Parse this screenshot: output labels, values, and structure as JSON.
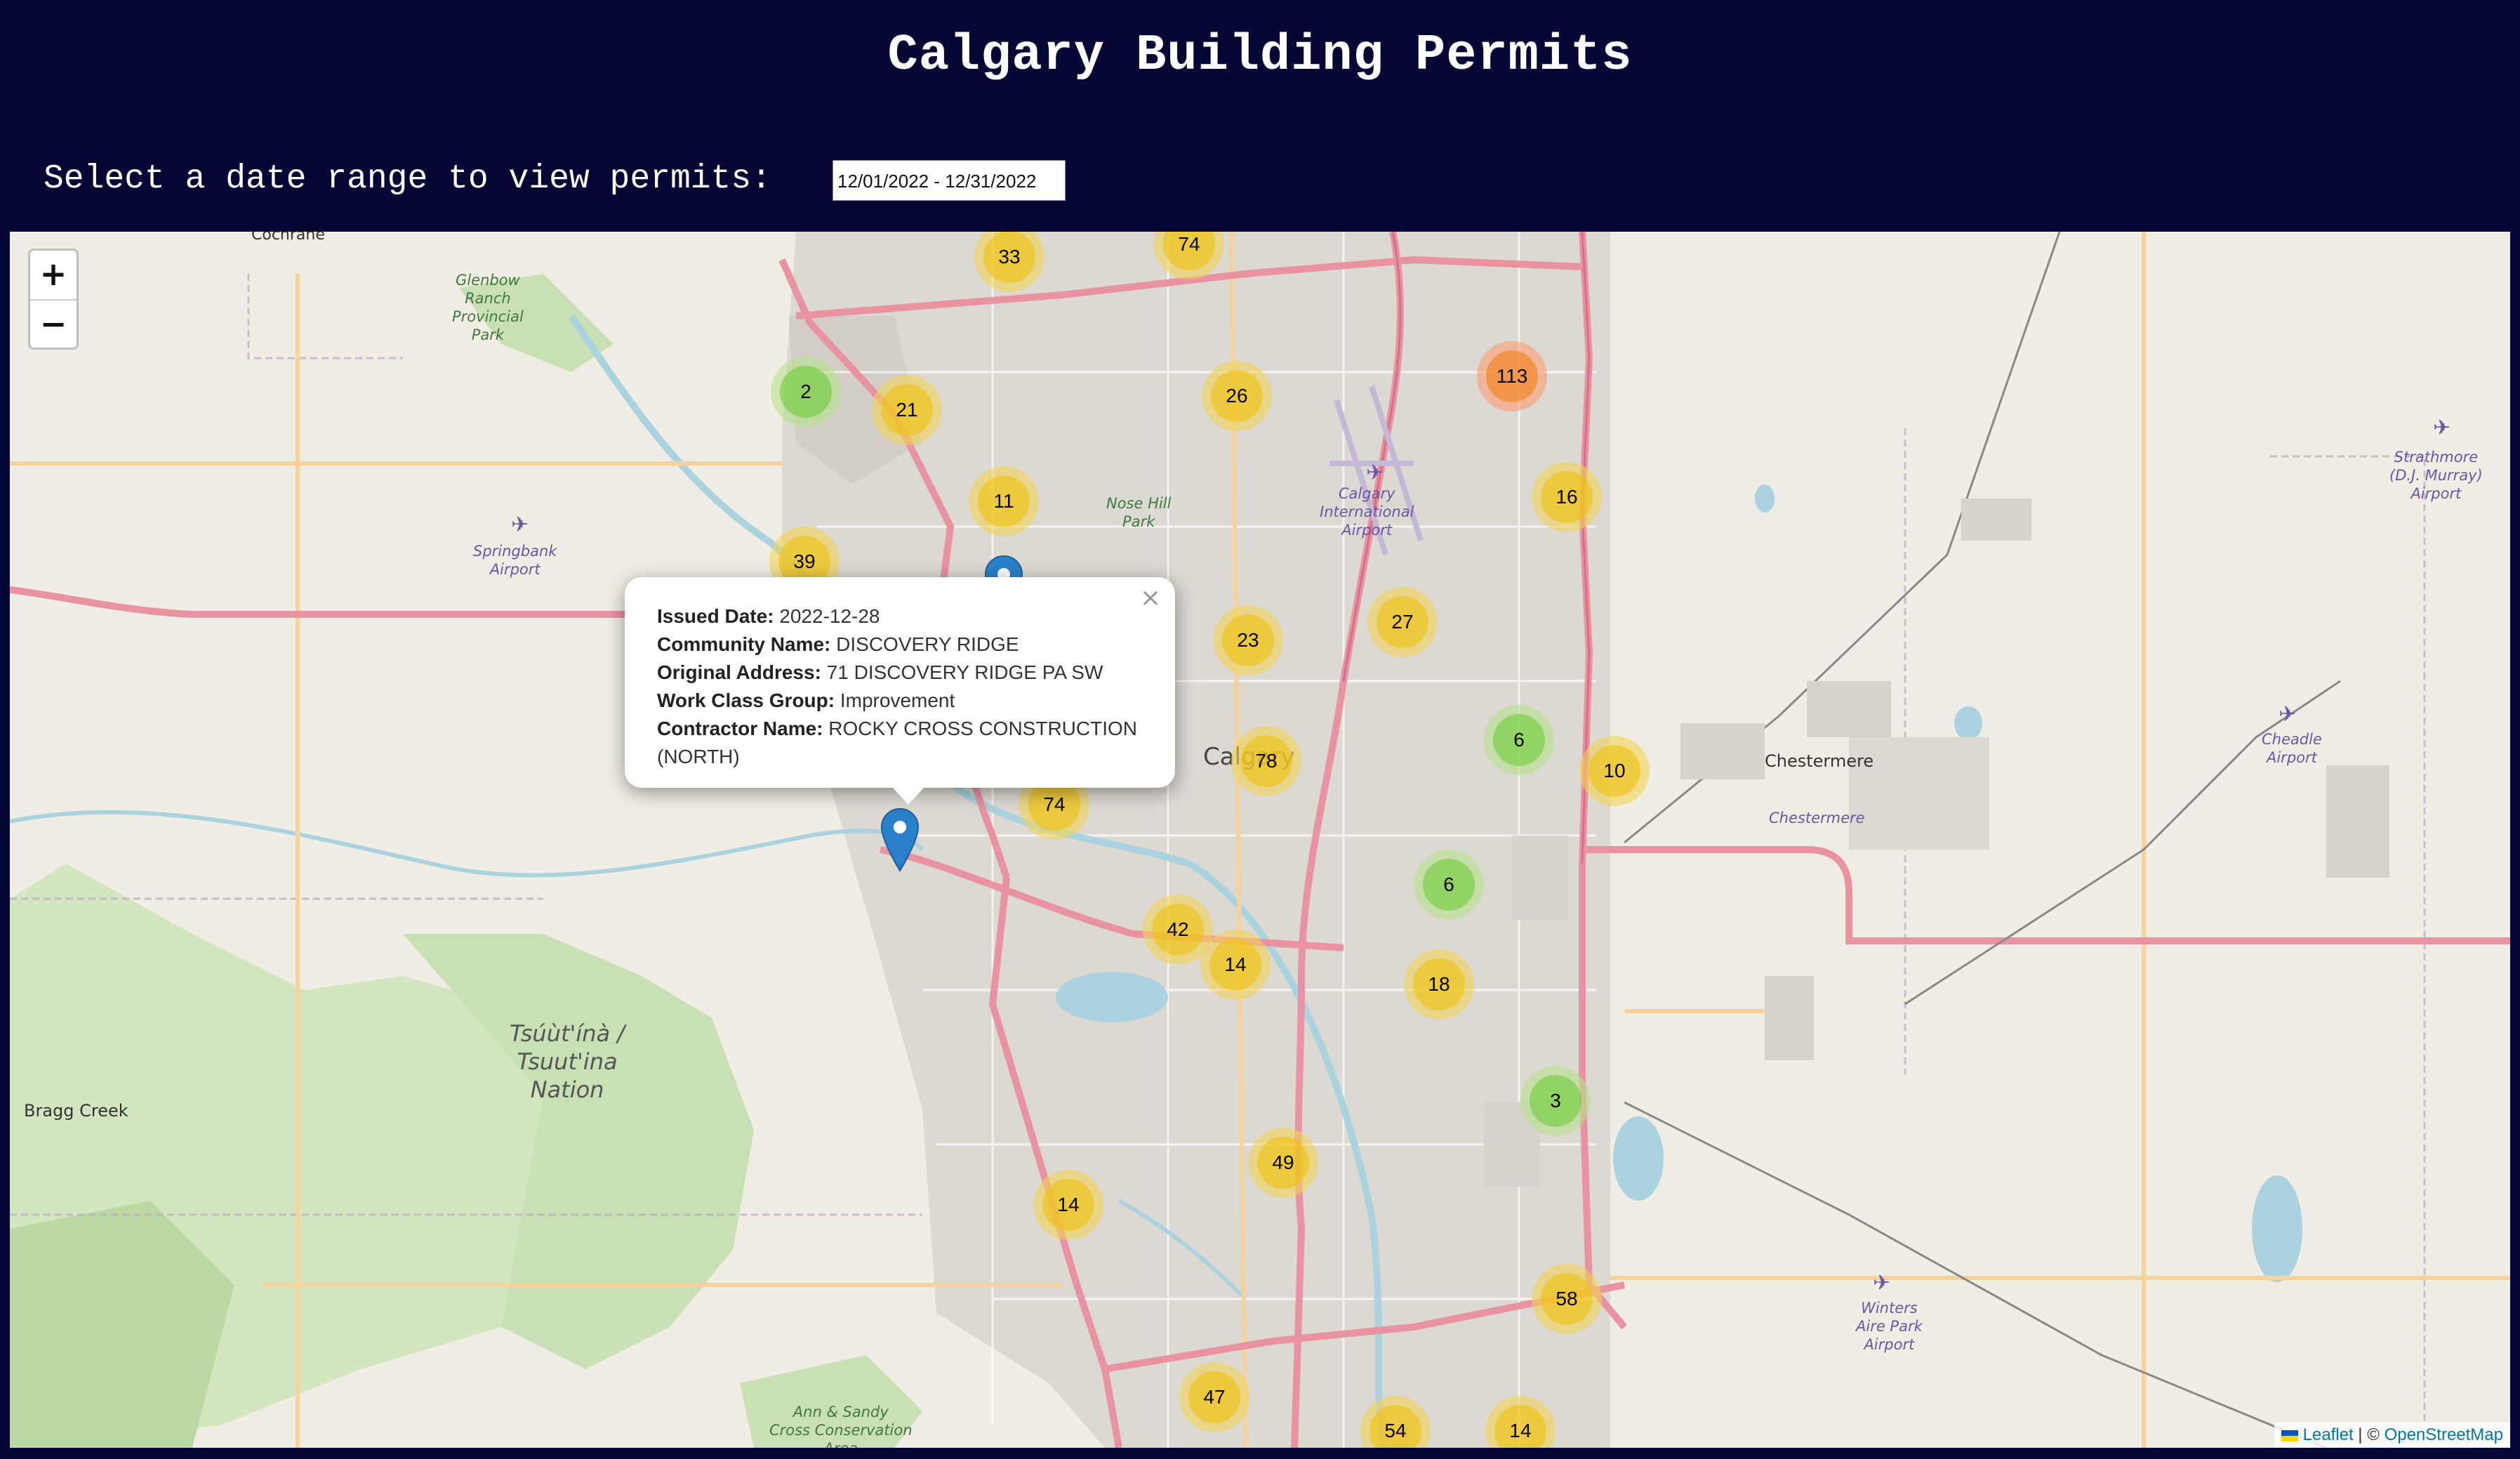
{
  "page": {
    "title": "Calgary Building Permits",
    "date_label": "Select a date range to view permits:",
    "date_range": "12/01/2022 - 12/31/2022"
  },
  "map": {
    "zoom_in": "+",
    "zoom_out": "−",
    "attribution": {
      "leaflet": "Leaflet",
      "separator": "| ©",
      "osm": "OpenStreetMap"
    },
    "place_labels": {
      "glenbow": "Glenbow\nRanch\nProvincial\nPark",
      "springbank": "Springbank\nAirport",
      "nose_hill": "Nose Hill\nPark",
      "calgary_airport": "Calgary\nInternational\nAirport",
      "calgary": "Calgary",
      "chestermere": "Chestermere",
      "chestermere_sub": "Chestermere",
      "strathmore": "Strathmore\n(D.J. Murray)\nAirport",
      "cheadle": "Cheadle\nAirport",
      "winters": "Winters\nAire Park\nAirport",
      "bragg_creek": "Bragg Creek",
      "tsuutina": "Tsúùt'ínà /\nTsuut'ina\nNation",
      "ann_sandy": "Ann & Sandy\nCross Conservation\nArea",
      "cochrane": "Cochrane"
    },
    "clusters": [
      {
        "count": "33",
        "size": "medium"
      },
      {
        "count": "74",
        "size": "medium"
      },
      {
        "count": "2",
        "size": "small"
      },
      {
        "count": "21",
        "size": "medium"
      },
      {
        "count": "26",
        "size": "medium"
      },
      {
        "count": "113",
        "size": "large"
      },
      {
        "count": "16",
        "size": "medium"
      },
      {
        "count": "11",
        "size": "medium"
      },
      {
        "count": "39",
        "size": "medium"
      },
      {
        "count": "23",
        "size": "medium"
      },
      {
        "count": "27",
        "size": "medium"
      },
      {
        "count": "6",
        "size": "small"
      },
      {
        "count": "10",
        "size": "medium"
      },
      {
        "count": "78",
        "size": "medium"
      },
      {
        "count": "74",
        "size": "medium"
      },
      {
        "count": "6",
        "size": "small"
      },
      {
        "count": "42",
        "size": "medium"
      },
      {
        "count": "14",
        "size": "medium"
      },
      {
        "count": "18",
        "size": "medium"
      },
      {
        "count": "3",
        "size": "small"
      },
      {
        "count": "49",
        "size": "medium"
      },
      {
        "count": "14",
        "size": "medium"
      },
      {
        "count": "58",
        "size": "medium"
      },
      {
        "count": "47",
        "size": "medium"
      },
      {
        "count": "54",
        "size": "medium"
      },
      {
        "count": "14",
        "size": "medium"
      }
    ],
    "popup": {
      "issued_date_label": "Issued Date:",
      "issued_date": "2022-12-28",
      "community_label": "Community Name:",
      "community": "DISCOVERY RIDGE",
      "address_label": "Original Address:",
      "address": "71 DISCOVERY RIDGE PA SW",
      "work_class_label": "Work Class Group:",
      "work_class": "Improvement",
      "contractor_label": "Contractor Name:",
      "contractor": "ROCKY CROSS CONSTRUCTION (NORTH)",
      "close": "×"
    },
    "colors": {
      "header_bg": "#050834",
      "cluster_small": "#6ecc39",
      "cluster_medium": "#f0c20c",
      "cluster_large": "#f18017",
      "marker": "#2a81cb"
    }
  }
}
